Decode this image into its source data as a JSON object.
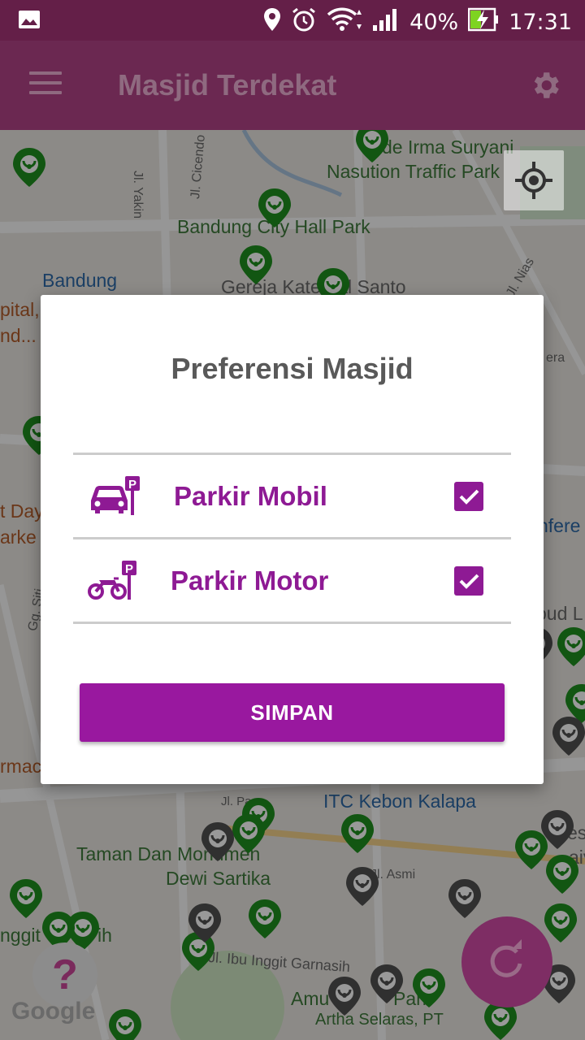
{
  "status_bar": {
    "battery": "40%",
    "time": "17:31",
    "icons": [
      "image-icon",
      "location-icon",
      "alarm-icon",
      "wifi-icon",
      "signal-icon",
      "battery-charging-icon"
    ]
  },
  "app_bar": {
    "title": "Masjid Terdekat",
    "menu_icon": "menu-icon",
    "settings_icon": "gear-icon"
  },
  "map": {
    "labels": [
      {
        "id": "irma",
        "text": "de Irma Suryani"
      },
      {
        "id": "nasution",
        "text": "Nasution Traffic Park"
      },
      {
        "id": "yakin",
        "text": "Jl. Yakin"
      },
      {
        "id": "cicendo",
        "text": "Jl. Cicendo"
      },
      {
        "id": "cityhall",
        "text": "Bandung City Hall Park"
      },
      {
        "id": "bandung",
        "text": "Bandung"
      },
      {
        "id": "gereja",
        "text": "Gereja Katedral Santo"
      },
      {
        "id": "nias",
        "text": "Jl. Nias"
      },
      {
        "id": "pital",
        "text": "pital,"
      },
      {
        "id": "nd",
        "text": "nd..."
      },
      {
        "id": "tday",
        "text": "t Day"
      },
      {
        "id": "arke",
        "text": "arke"
      },
      {
        "id": "siti",
        "text": "Gg. Siti"
      },
      {
        "id": "nfere",
        "text": "nfere"
      },
      {
        "id": "oudl",
        "text": "oud L"
      },
      {
        "id": "era",
        "text": "era"
      },
      {
        "id": "rmac",
        "text": "rmac"
      },
      {
        "id": "itc",
        "text": "ITC Kebon Kalapa"
      },
      {
        "id": "jlpa",
        "text": "Jl. Pa"
      },
      {
        "id": "taman1",
        "text": "Taman Dan Monumen"
      },
      {
        "id": "taman2",
        "text": "Dewi Sartika"
      },
      {
        "id": "asmi",
        "text": "Jl. Asmi"
      },
      {
        "id": "inggit",
        "text": "Jl. Ibu Inggit Garnasih"
      },
      {
        "id": "nggit",
        "text": "nggit G"
      },
      {
        "id": "ih",
        "text": "ih"
      },
      {
        "id": "amu",
        "text": "Amu"
      },
      {
        "id": "park",
        "text": "Park"
      },
      {
        "id": "artha",
        "text": "Artha Selaras, PT"
      },
      {
        "id": "es",
        "text": "es"
      },
      {
        "id": "aiv",
        "text": "aiv"
      }
    ],
    "logo": "Google",
    "help_label": "?",
    "locate_icon": "my-location-icon",
    "refresh_icon": "refresh-icon"
  },
  "dialog": {
    "title": "Preferensi Masjid",
    "options": [
      {
        "label": "Parkir Mobil",
        "icon": "car-parking-icon",
        "checked": true
      },
      {
        "label": "Parkir Motor",
        "icon": "motorcycle-parking-icon",
        "checked": true
      }
    ],
    "save_label": "SIMPAN"
  },
  "colors": {
    "app_bar": "#6b2851",
    "status_bar": "#641f48",
    "accent": "#8e1a94",
    "button": "#99189f",
    "pin_green": "#1e8f1e",
    "pin_grey": "#505050"
  }
}
